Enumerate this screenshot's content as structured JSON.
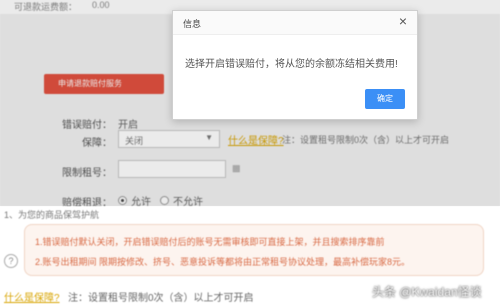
{
  "background_page": {
    "top_strip": {
      "label": "可退款运费额：",
      "value": "0.00"
    },
    "claim_button_label": "申请退款赔付服务",
    "form": {
      "error_payment_label": "错误赔付：",
      "error_payment_value": "开启",
      "guarantee_label": "保障：",
      "guarantee_select_value": "关闭",
      "what_is_guarantee_link": "什么是保障?",
      "guarantee_note": "注：设置租号限制0次（含）以上才可开启",
      "limit_label": "限制租号：",
      "limit_unit_icon": "calendar-icon",
      "allow_return_label": "赔偿租退：",
      "radio_allow": "允许",
      "radio_deny": "不允许",
      "radio_selected": "允许"
    },
    "section_title": "1、为您的商品保驾护航",
    "tips": [
      "1.错误赔付默认关闭，开启错误赔付后的账号无需审核即可直接上架，并且搜索排序靠前",
      "2.账号出租期间 限期按修改、挤号、恶意投诉等都将由正常租号协议处理，最高补偿玩家8元。"
    ],
    "bottom_link": "什么是保障?",
    "bottom_note": "注：设置租号限制0次（含）以上才可开启",
    "watermark": "头条 @Kwaidan怪谈"
  },
  "modal": {
    "title": "信息",
    "close_symbol": "×",
    "message": "选择开启错误赔付，将从您的余额冻结相关费用!",
    "ok_label": "确定"
  },
  "colors": {
    "accent_blue": "#3b8ff6",
    "claim_red": "#e2513f",
    "link_gold": "#d8a400",
    "tip_text": "#d86a45"
  }
}
